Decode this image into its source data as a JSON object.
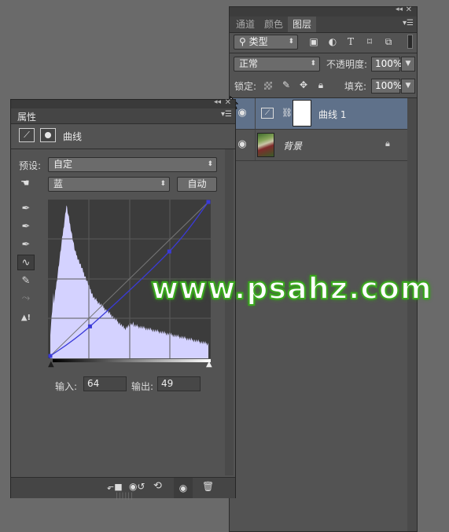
{
  "layers_panel": {
    "tabs": [
      "通道",
      "颜色",
      "图层"
    ],
    "active_tab": "图层",
    "filter_kind": "类型",
    "blend_mode": "正常",
    "opacity_label": "不透明度:",
    "opacity_value": "100%",
    "lock_label": "锁定:",
    "fill_label": "填充:",
    "fill_value": "100%",
    "layers": [
      {
        "name": "曲线 1",
        "type": "adjustment",
        "selected": true
      },
      {
        "name": "背景",
        "type": "image",
        "selected": false,
        "locked": true
      }
    ]
  },
  "properties_panel": {
    "title": "属性",
    "adjustment_name": "曲线",
    "preset_label": "预设:",
    "preset_value": "自定",
    "channel_value": "蓝",
    "auto_label": "自动",
    "input_label": "输入:",
    "input_value": "64",
    "output_label": "输出:",
    "output_value": "49"
  },
  "curve": {
    "points": [
      [
        0,
        0
      ],
      [
        64,
        49
      ],
      [
        192,
        173
      ],
      [
        255,
        255
      ]
    ],
    "histogram_color": "#d4d2ff",
    "curve_color": "#3a3ad8"
  },
  "watermark": "www.psahz.com",
  "colors": {
    "panel_bg": "#535353",
    "selected_layer_bg": "#5f718a",
    "watermark_stroke": "#3aa81e"
  }
}
